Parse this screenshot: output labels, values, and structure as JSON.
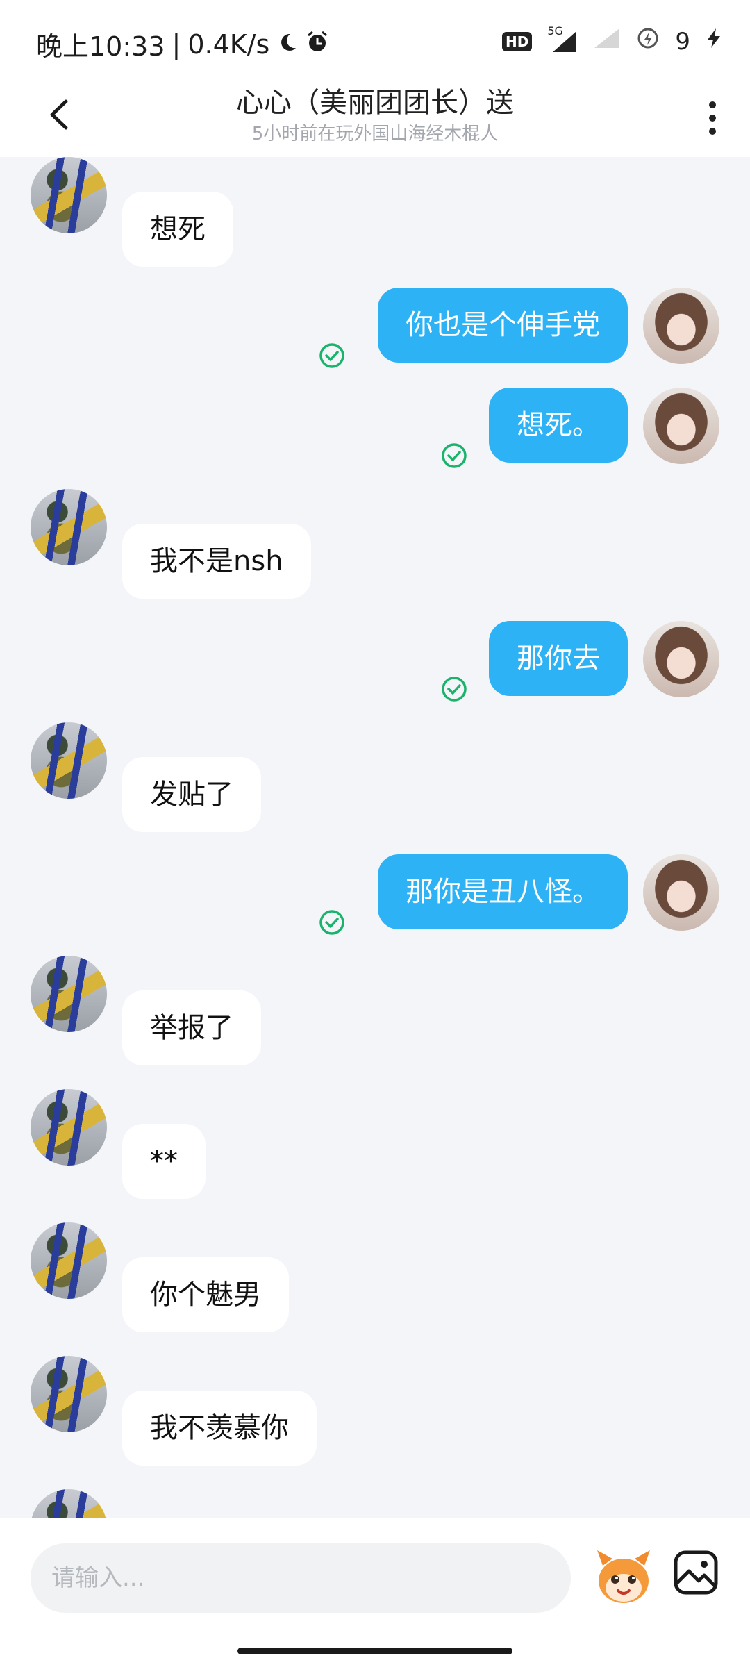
{
  "status_bar": {
    "time": "晚上10:33",
    "separator": "|",
    "net_speed": "0.4K/s",
    "hd": "HD",
    "network": "5G",
    "battery": "9"
  },
  "header": {
    "title": "心心（美丽团团长）送",
    "subtitle": "5小时前在玩外国山海经木棍人"
  },
  "messages": [
    {
      "from": "other",
      "text": "想死"
    },
    {
      "from": "me",
      "text": "你也是个伸手党"
    },
    {
      "from": "me",
      "text": "想死。"
    },
    {
      "from": "other",
      "text": "我不是nsh"
    },
    {
      "from": "me",
      "text": "那你去"
    },
    {
      "from": "other",
      "text": "发贴了"
    },
    {
      "from": "me",
      "text": "那你是丑八怪。"
    },
    {
      "from": "other",
      "text": "举报了"
    },
    {
      "from": "other",
      "text": "**"
    },
    {
      "from": "other",
      "text": "你个魅男"
    },
    {
      "from": "other",
      "text": "我不羡慕你"
    }
  ],
  "input": {
    "placeholder": "请输入..."
  },
  "colors": {
    "my_bubble": "#2DB2F5",
    "their_bubble": "#FFFFFF",
    "background": "#F3F5F9",
    "sent_check": "#19B36B"
  },
  "icons": {
    "back": "chevron-left-icon",
    "more": "more-vertical-icon",
    "sent": "check-circle-icon",
    "emoji": "mascot-emoji-icon",
    "image": "image-icon"
  }
}
